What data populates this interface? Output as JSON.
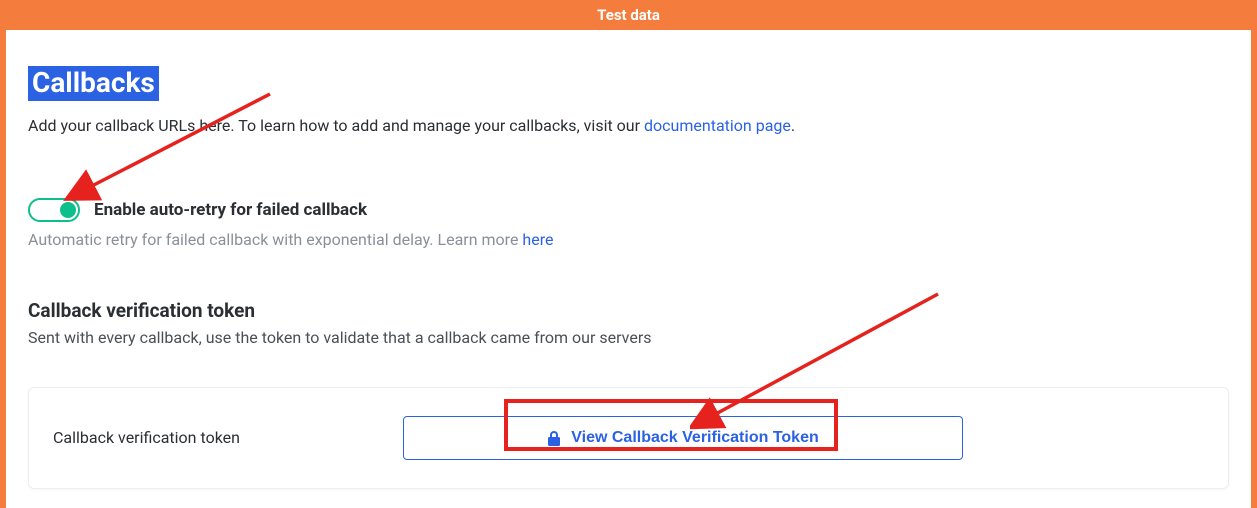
{
  "header": {
    "title": "Test data"
  },
  "callbacks": {
    "title": "Callbacks",
    "intro_pre": "Add your callback URLs here. To learn how to add and manage your callbacks, visit our ",
    "intro_link": "documentation page",
    "intro_post": ".",
    "toggle": {
      "checked": true,
      "label": "Enable auto-retry for failed callback",
      "desc_pre": "Automatic retry for failed callback with exponential delay. Learn more ",
      "desc_link": "here"
    },
    "token": {
      "heading": "Callback verification token",
      "sub": "Sent with every callback, use the token to validate that a callback came from our servers",
      "field_label": "Callback verification token",
      "button_label": "View Callback Verification Token"
    }
  },
  "colors": {
    "accent_orange": "#f47c3c",
    "primary_blue": "#2b62e3",
    "toggle_green": "#0dbf8a",
    "annotation_red": "#e5221e"
  }
}
